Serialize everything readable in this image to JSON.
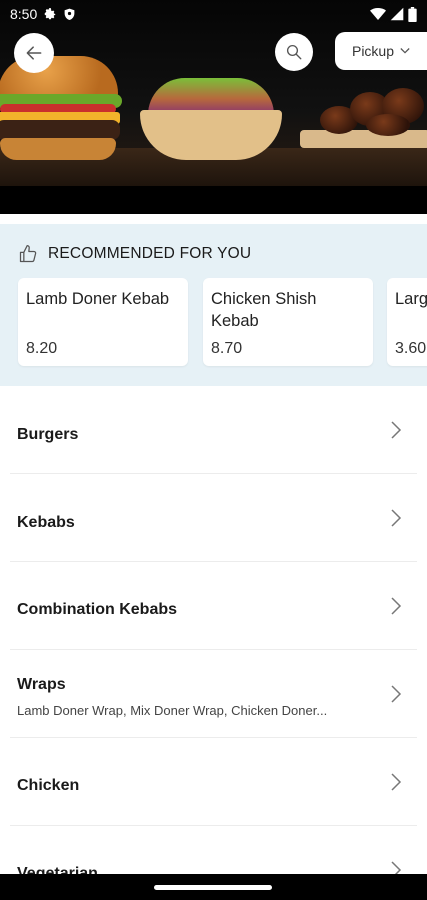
{
  "status_bar": {
    "time": "8:50",
    "icons": [
      "gear-icon",
      "shield-icon",
      "wifi-icon",
      "signal-icon",
      "battery-icon"
    ]
  },
  "header": {
    "back_icon": "arrow-left-icon",
    "search_icon": "search-icon",
    "pickup_label": "Pickup",
    "pickup_chevron_icon": "chevron-down-icon"
  },
  "recommended": {
    "icon": "thumbs-up-icon",
    "title": "RECOMMENDED FOR YOU",
    "items": [
      {
        "name": "Lamb Doner Kebab",
        "price": "8.20"
      },
      {
        "name": "Chicken Shish Kebab",
        "price": "8.70"
      },
      {
        "name": "Larg",
        "price": "3.60"
      }
    ]
  },
  "categories": [
    {
      "name": "Burgers",
      "subtitle": ""
    },
    {
      "name": "Kebabs",
      "subtitle": ""
    },
    {
      "name": "Combination Kebabs",
      "subtitle": ""
    },
    {
      "name": "Wraps",
      "subtitle": "Lamb Doner Wrap, Mix Doner Wrap, Chicken Doner..."
    },
    {
      "name": "Chicken",
      "subtitle": ""
    },
    {
      "name": "Vegetarian",
      "subtitle": ""
    }
  ],
  "colors": {
    "recommended_bg": "#e6f1f6",
    "text": "#1a1a1a",
    "divider": "#ececec"
  }
}
